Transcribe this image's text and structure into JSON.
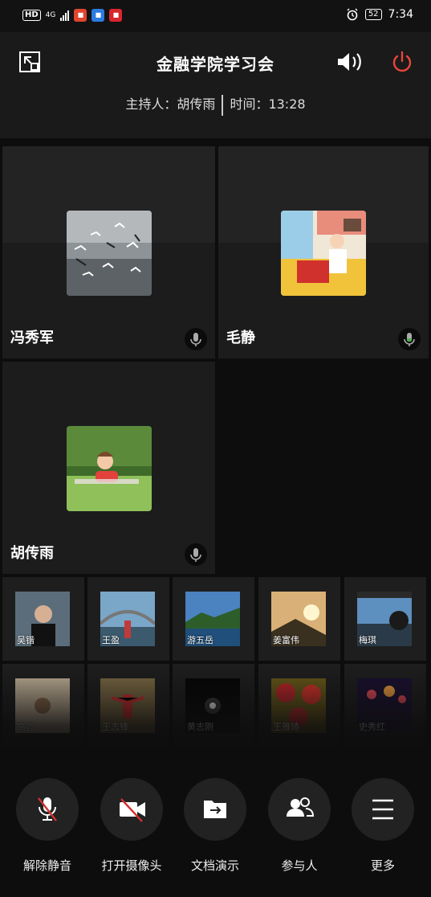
{
  "status_bar": {
    "hd": "HD",
    "network": "4G",
    "battery": "52",
    "time": "7:34",
    "app_icons": [
      "app-red-icon",
      "app-blue-icon",
      "app-red2-icon"
    ]
  },
  "header": {
    "title": "金融学院学习会",
    "host_label": "主持人：胡传雨",
    "time_label": "时间：13:28",
    "icons": {
      "left": "exit-fullscreen-icon",
      "speaker": "speaker-icon",
      "power": "power-icon"
    },
    "accent_color": "#e8463a"
  },
  "participants_main": [
    {
      "name": "冯秀军",
      "photo": "seagulls-photo"
    },
    {
      "name": "毛静",
      "photo": "cartoon-office-photo"
    },
    {
      "name": "胡传雨",
      "photo": "child-on-grass-photo"
    }
  ],
  "participants_strip": [
    {
      "name": "吴锴"
    },
    {
      "name": "王盈"
    },
    {
      "name": "游五岳"
    },
    {
      "name": "姜富伟"
    },
    {
      "name": "梅琪"
    },
    {
      "name": "高言"
    },
    {
      "name": "王志锋"
    },
    {
      "name": "黄志刚"
    },
    {
      "name": "王雅琦"
    },
    {
      "name": "史秀红"
    }
  ],
  "controls": [
    {
      "label": "解除静音",
      "icon": "mic-muted-icon"
    },
    {
      "label": "打开摄像头",
      "icon": "camera-off-icon"
    },
    {
      "label": "文档演示",
      "icon": "document-share-icon"
    },
    {
      "label": "参与人",
      "icon": "participants-icon"
    },
    {
      "label": "更多",
      "icon": "menu-icon"
    }
  ]
}
